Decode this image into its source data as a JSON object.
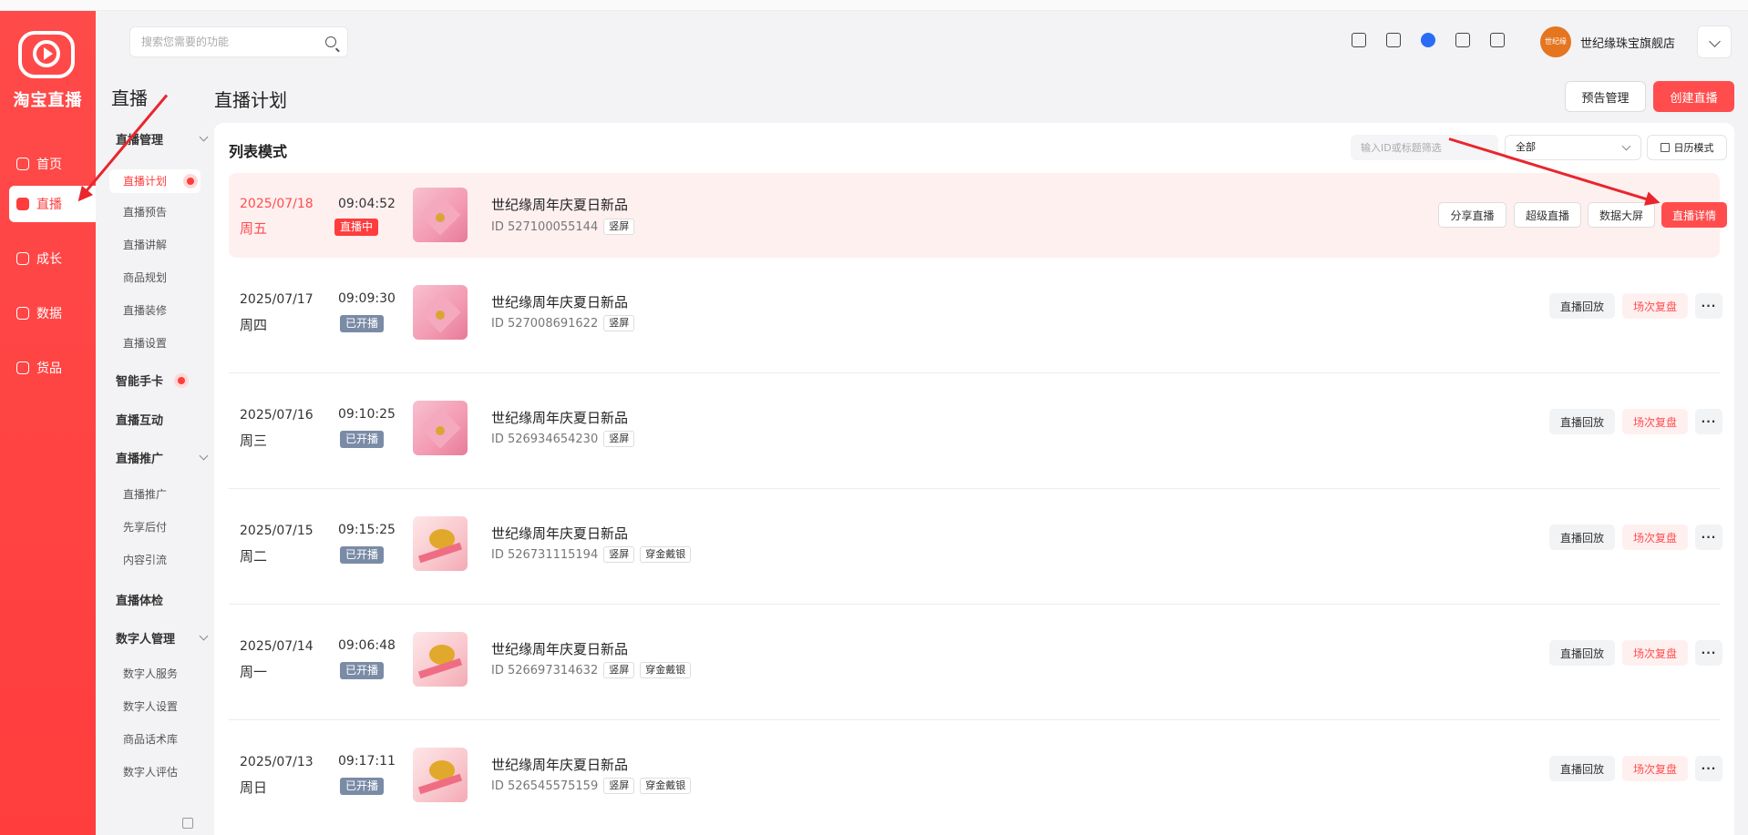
{
  "app": {
    "logo_text": "淘宝直播"
  },
  "leftnav": {
    "items": [
      {
        "label": "首页",
        "icon": "home-icon",
        "active": false
      },
      {
        "label": "直播",
        "icon": "live-icon",
        "active": true
      },
      {
        "label": "成长",
        "icon": "growth-icon",
        "active": false
      },
      {
        "label": "数据",
        "icon": "data-icon",
        "active": false
      },
      {
        "label": "货品",
        "icon": "goods-icon",
        "active": false
      }
    ]
  },
  "subnav": {
    "title": "直播",
    "groups": {
      "live_manage": "直播管理",
      "smart_card": "智能手卡",
      "live_interact": "直播互动",
      "live_promo": "直播推广",
      "live_check": "直播体检",
      "digital_human": "数字人管理"
    },
    "items": {
      "plan": "直播计划",
      "preview": "直播预告",
      "explain": "直播讲解",
      "goods_plan": "商品规划",
      "decor": "直播装修",
      "settings": "直播设置",
      "promo": "直播推广",
      "pay_later": "先享后付",
      "content_flow": "内容引流",
      "dh_service": "数字人服务",
      "dh_settings": "数字人设置",
      "dh_script": "商品话术库",
      "dh_eval": "数字人评估"
    }
  },
  "header": {
    "search_placeholder": "搜索您需要的功能",
    "shop_name": "世纪缘珠宝旗舰店",
    "shop_avatar_text": "世纪缘"
  },
  "page": {
    "title": "直播计划",
    "preview_btn": "预告管理",
    "create_btn": "创建直播"
  },
  "list": {
    "mode_title": "列表模式",
    "filter_placeholder": "输入ID或标题筛选",
    "filter_select": "全部",
    "calendar_btn": "日历模式",
    "rows": [
      {
        "date": "2025/07/18",
        "weekday": "周五",
        "time": "09:04:52",
        "status": "直播中",
        "live": true,
        "thumb": "heart",
        "title": "世纪缘周年庆夏日新品",
        "id": "ID  527100055144",
        "tags": [
          "竖屏"
        ],
        "actions": [
          "分享直播",
          "超级直播",
          "数据大屏",
          "直播详情"
        ]
      },
      {
        "date": "2025/07/17",
        "weekday": "周四",
        "time": "09:09:30",
        "status": "已开播",
        "live": false,
        "thumb": "heart",
        "title": "世纪缘周年庆夏日新品",
        "id": "ID  527008691622",
        "tags": [
          "竖屏"
        ],
        "actions": [
          "直播回放",
          "场次复盘",
          "···"
        ]
      },
      {
        "date": "2025/07/16",
        "weekday": "周三",
        "time": "09:10:25",
        "status": "已开播",
        "live": false,
        "thumb": "heart",
        "title": "世纪缘周年庆夏日新品",
        "id": "ID  526934654230",
        "tags": [
          "竖屏"
        ],
        "actions": [
          "直播回放",
          "场次复盘",
          "···"
        ]
      },
      {
        "date": "2025/07/15",
        "weekday": "周二",
        "time": "09:15:25",
        "status": "已开播",
        "live": false,
        "thumb": "gold",
        "title": "世纪缘周年庆夏日新品",
        "id": "ID  526731115194",
        "tags": [
          "竖屏",
          "穿金戴银"
        ],
        "actions": [
          "直播回放",
          "场次复盘",
          "···"
        ]
      },
      {
        "date": "2025/07/14",
        "weekday": "周一",
        "time": "09:06:48",
        "status": "已开播",
        "live": false,
        "thumb": "gold",
        "title": "世纪缘周年庆夏日新品",
        "id": "ID  526697314632",
        "tags": [
          "竖屏",
          "穿金戴银"
        ],
        "actions": [
          "直播回放",
          "场次复盘",
          "···"
        ]
      },
      {
        "date": "2025/07/13",
        "weekday": "周日",
        "time": "09:17:11",
        "status": "已开播",
        "live": false,
        "thumb": "gold",
        "title": "世纪缘周年庆夏日新品",
        "id": "ID  526545575159",
        "tags": [
          "竖屏",
          "穿金戴银"
        ],
        "actions": [
          "直播回放",
          "场次复盘",
          "···"
        ]
      }
    ]
  },
  "colors": {
    "brand_red": "#ff3d3d",
    "status_grey": "#7a8ba6",
    "live_row_bg": "#fff0f0"
  }
}
